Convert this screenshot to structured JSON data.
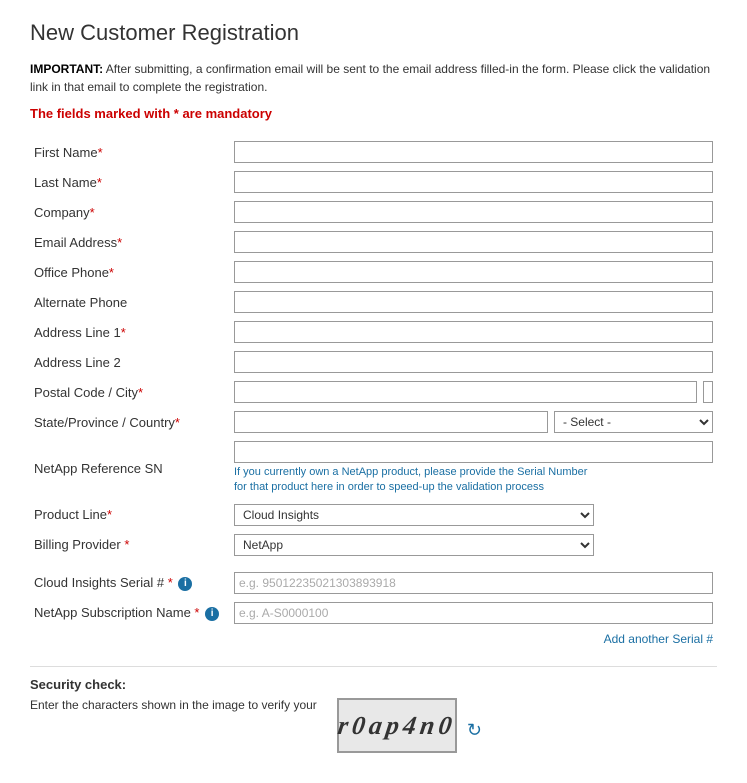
{
  "page": {
    "title": "New Customer Registration",
    "important_label": "IMPORTANT:",
    "important_text": " After submitting, a confirmation email will be sent to the email address filled-in the form. Please click the validation link in that email to complete the registration.",
    "mandatory_note": "The fields marked with ",
    "mandatory_star": "*",
    "mandatory_note2": " are mandatory"
  },
  "form": {
    "fields": [
      {
        "label": "First Name",
        "required": true,
        "name": "first-name"
      },
      {
        "label": "Last Name",
        "required": true,
        "name": "last-name"
      },
      {
        "label": "Company",
        "required": true,
        "name": "company"
      },
      {
        "label": "Email Address",
        "required": true,
        "name": "email-address"
      },
      {
        "label": "Office Phone",
        "required": true,
        "name": "office-phone"
      },
      {
        "label": "Alternate Phone",
        "required": false,
        "name": "alternate-phone"
      },
      {
        "label": "Address Line 1",
        "required": true,
        "name": "address-line-1"
      },
      {
        "label": "Address Line 2",
        "required": false,
        "name": "address-line-2"
      }
    ],
    "postal_label": "Postal Code / City",
    "postal_required": true,
    "state_label": "State/Province / Country",
    "state_required": true,
    "state_select_default": "- Select -",
    "netapp_ref_label": "NetApp Reference SN",
    "netapp_ref_required": false,
    "netapp_hint": "If you currently own a NetApp product, please provide the Serial Number for that product here in order to speed-up the validation process",
    "product_line_label": "Product Line",
    "product_line_required": true,
    "product_line_value": "Cloud Insights",
    "billing_provider_label": "Billing Provider",
    "billing_provider_required": true,
    "billing_provider_value": "NetApp",
    "cloud_serial_label": "Cloud Insights Serial #",
    "cloud_serial_required": true,
    "cloud_serial_placeholder": "e.g. 95012235021303893918",
    "netapp_sub_label": "NetApp Subscription Name",
    "netapp_sub_required": true,
    "netapp_sub_placeholder": "e.g. A-S0000100",
    "add_serial_link": "Add another Serial #"
  },
  "security": {
    "title": "Security check:",
    "description": "Enter the characters shown in the image to verify your",
    "captcha_text": "r0ap4n0"
  }
}
